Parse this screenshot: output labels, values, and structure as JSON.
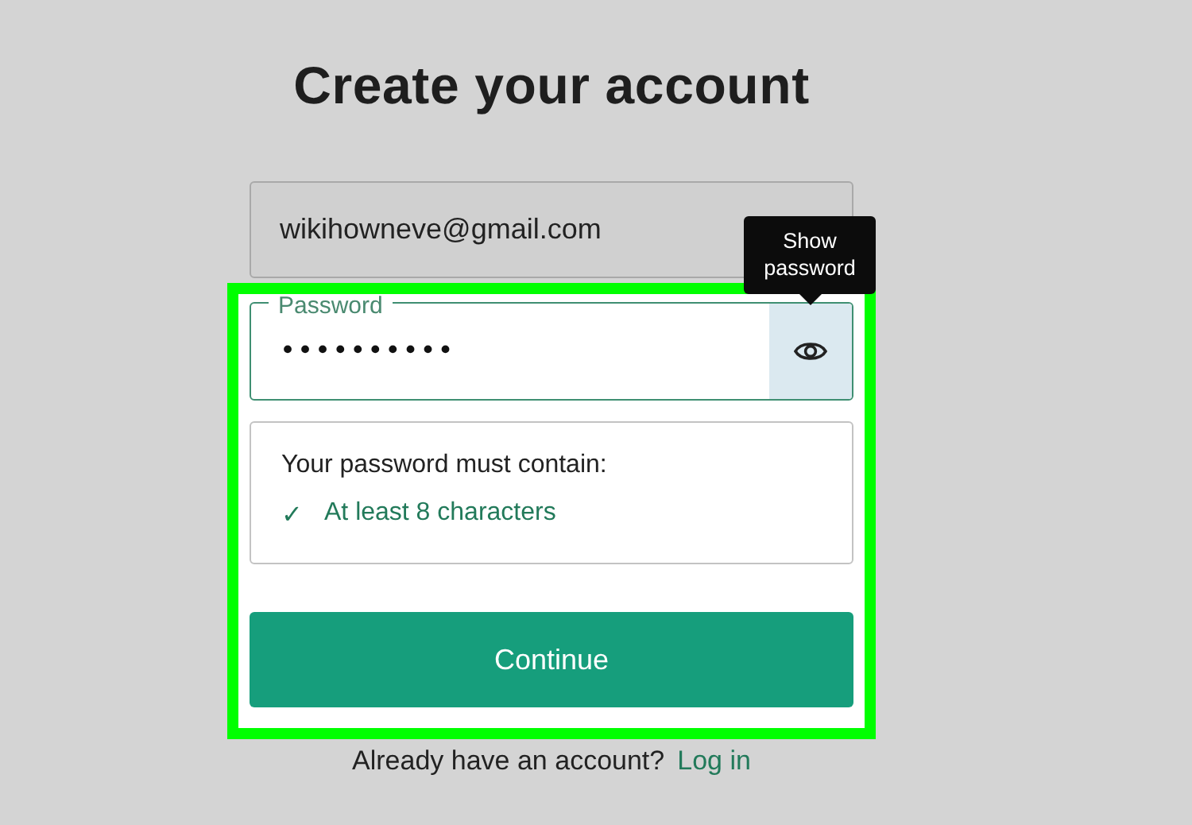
{
  "title": "Create your account",
  "email_field": {
    "value": "wikihowneve@gmail.com"
  },
  "highlight": {
    "color": "#00ff00"
  },
  "password_field": {
    "label": "Password",
    "value": "••••••••••",
    "focused": true
  },
  "tooltip": {
    "text": "Show password"
  },
  "requirements": {
    "heading": "Your password must contain:",
    "items": [
      {
        "mark": "✓",
        "text": "At least 8 characters",
        "met": true
      }
    ]
  },
  "continue_button": {
    "label": "Continue"
  },
  "footer": {
    "text": "Already have an account?",
    "link": "Log in"
  }
}
